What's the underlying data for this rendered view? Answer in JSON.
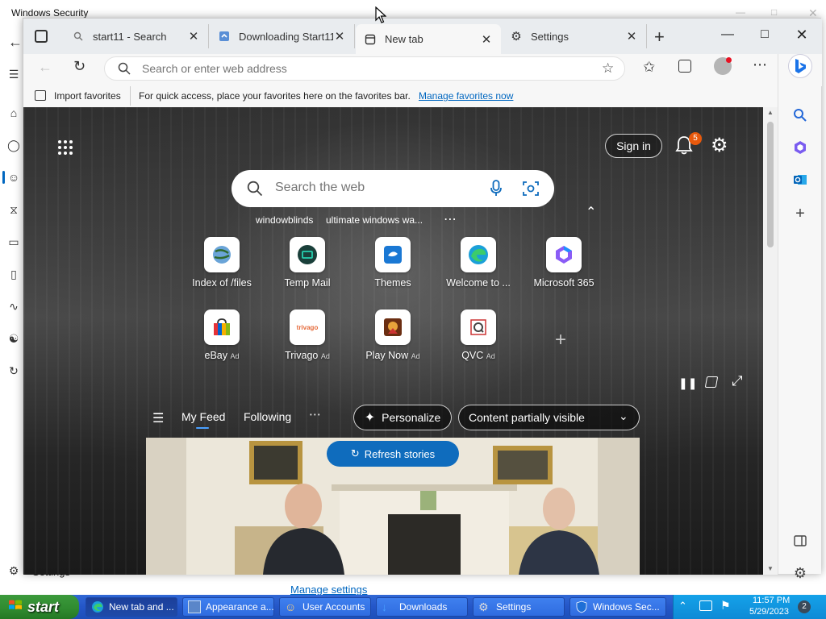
{
  "background_window": {
    "title": "Windows Security",
    "settings_label": "Settings",
    "manage_settings": "Manage settings"
  },
  "tabs": [
    {
      "label": "start11 - Search",
      "icon": "search-icon"
    },
    {
      "label": "Downloading Start11",
      "icon": "download-page-icon"
    },
    {
      "label": "New tab",
      "icon": "new-tab-icon"
    },
    {
      "label": "Settings",
      "icon": "gear-icon"
    }
  ],
  "address_bar": {
    "placeholder": "Search or enter web address"
  },
  "favorites_bar": {
    "import_label": "Import favorites",
    "message": "For quick access, place your favorites here on the favorites bar.",
    "manage_link": "Manage favorites now"
  },
  "newtab": {
    "sign_in": "Sign in",
    "notification_count": "5",
    "search_placeholder": "Search the web",
    "recent_searches": [
      "windowblinds",
      "ultimate windows wa..."
    ],
    "more": "⋯",
    "shortcuts": [
      {
        "label": "Index of /files",
        "ad": ""
      },
      {
        "label": "Temp Mail",
        "ad": ""
      },
      {
        "label": "Themes",
        "ad": ""
      },
      {
        "label": "Welcome to ...",
        "ad": ""
      },
      {
        "label": "Microsoft 365",
        "ad": ""
      },
      {
        "label": "eBay",
        "ad": "Ad"
      },
      {
        "label": "Trivago",
        "ad": "Ad"
      },
      {
        "label": "Play Now",
        "ad": "Ad"
      },
      {
        "label": "QVC",
        "ad": "Ad"
      }
    ],
    "trivago_logo_text": "trivago",
    "feed_tabs": [
      "My Feed",
      "Following"
    ],
    "personalize": "Personalize",
    "content_visibility": "Content partially visible",
    "refresh_stories": "Refresh stories"
  },
  "taskbar": {
    "start": "start",
    "tasks": [
      {
        "label": "New tab and ..."
      },
      {
        "label": "Appearance a..."
      },
      {
        "label": "User Accounts"
      },
      {
        "label": "Downloads"
      },
      {
        "label": "Settings"
      },
      {
        "label": "Windows Sec..."
      }
    ],
    "time": "11:57 PM",
    "date": "5/29/2023",
    "badge": "2"
  },
  "colors": {
    "accent": "#0067c0",
    "taskbar": "#2456c8",
    "start": "#2f8a2f",
    "refresh_button": "#0f6cbd"
  }
}
